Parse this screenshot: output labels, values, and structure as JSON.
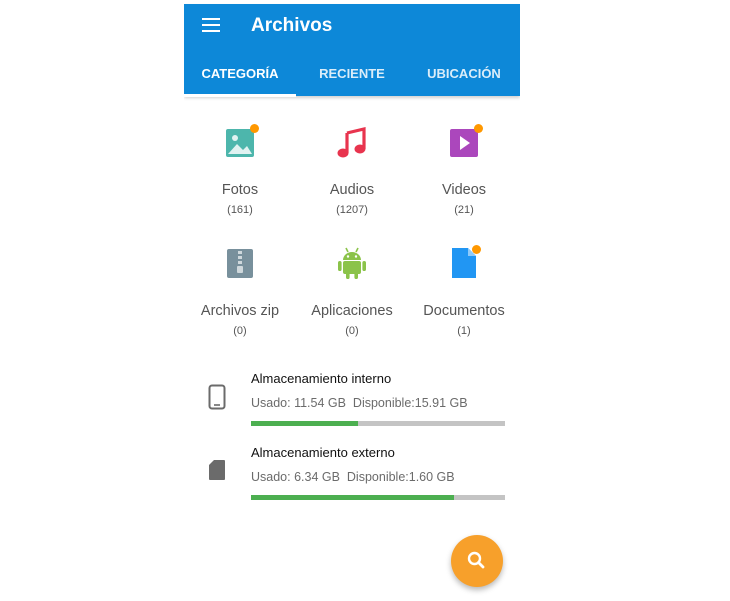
{
  "app": {
    "title": "Archivos"
  },
  "tabs": [
    {
      "label": "CATEGORÍA",
      "active": true
    },
    {
      "label": "RECIENTE",
      "active": false
    },
    {
      "label": "UBICACIÓN",
      "active": false
    }
  ],
  "categories": [
    {
      "label": "Fotos",
      "count": "(161)",
      "icon": "image-icon",
      "color": "#4db6ac",
      "badge": true
    },
    {
      "label": "Audios",
      "count": "(1207)",
      "icon": "music-note-icon",
      "color": "#e8344e",
      "badge": false
    },
    {
      "label": "Videos",
      "count": "(21)",
      "icon": "video-play-icon",
      "color": "#ab47bc",
      "badge": true
    },
    {
      "label": "Archivos zip",
      "count": "(0)",
      "icon": "zip-file-icon",
      "color": "#78909c",
      "badge": false
    },
    {
      "label": "Aplicaciones",
      "count": "(0)",
      "icon": "android-icon",
      "color": "#8bc34a",
      "badge": false
    },
    {
      "label": "Documentos",
      "count": "(1)",
      "icon": "document-icon",
      "color": "#2196f3",
      "badge": true
    }
  ],
  "storage": [
    {
      "name": "Almacenamiento interno",
      "used": "Usado: 11.54 GB",
      "available": "Disponible:15.91 GB",
      "used_fraction": 0.42,
      "icon": "phone-icon"
    },
    {
      "name": "Almacenamiento externo",
      "used": "Usado: 6.34 GB",
      "available": "Disponible:1.60 GB",
      "used_fraction": 0.8,
      "icon": "sd-card-icon"
    }
  ],
  "colors": {
    "appbar": "#0d88d8",
    "accent": "#f7a02b",
    "badge": "#ff9800",
    "progress": "#4caf50"
  },
  "fab": {
    "icon": "search-icon"
  }
}
